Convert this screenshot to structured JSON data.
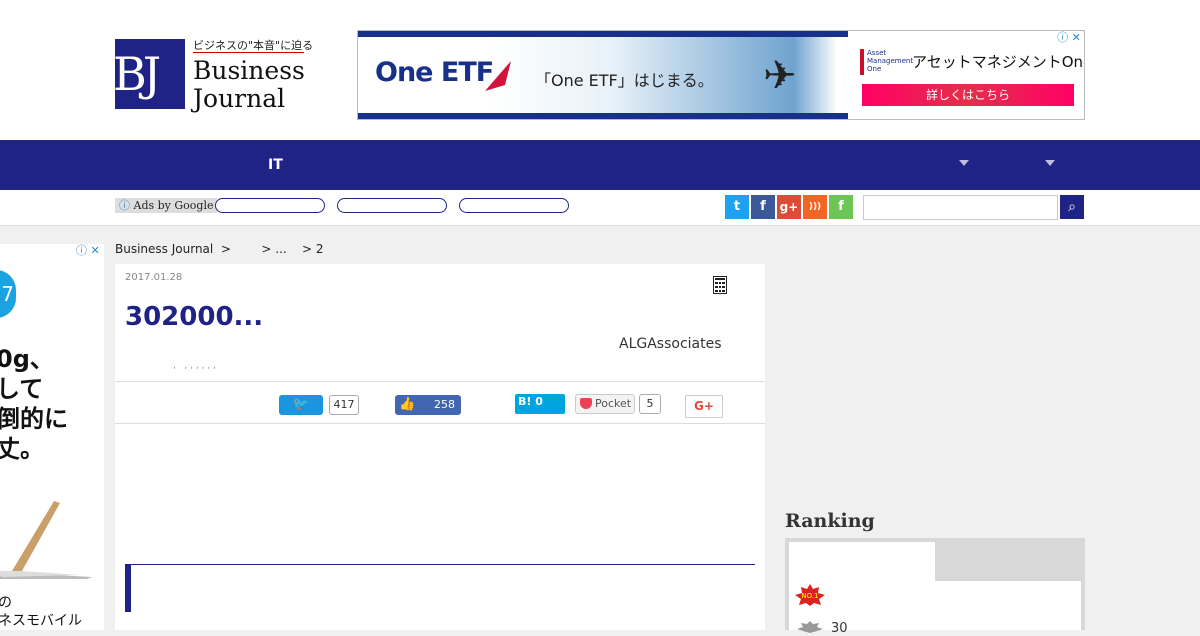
{
  "header": {
    "logo": {
      "mark": "BJ",
      "tagline": "ビジネスの\"本音\"に迫る",
      "word1": "Business",
      "word2": "Journal"
    },
    "ad": {
      "brand": "One ETF",
      "copy": "「One ETF」はじまる。",
      "company_logo": "Asset Management One",
      "company": "アセットマネジメントOne",
      "cta": "詳しくはこちら",
      "choices": "ⓘ ✕"
    }
  },
  "nav": {
    "items": [
      "IT"
    ]
  },
  "subbar": {
    "ads_by": "Ads by Google",
    "ads_icon": "ⓘ",
    "social": [
      "twitter",
      "facebook",
      "google-plus",
      "rss",
      "feedly"
    ],
    "social_glyphs": {
      "twitter": "t",
      "facebook": "f",
      "gplus": "g+",
      "rss": ")))",
      "feedly": "f"
    },
    "search_icon": "⌕"
  },
  "side_ad": {
    "choices": "ⓘ ✕",
    "badge": "7",
    "headline": "0g、\nして\n倒的に\n丈。",
    "footer": "の\nネスモバイル"
  },
  "breadcrumb": "Business Journal  >        > ...    > 2",
  "article": {
    "date": "2017.01.28",
    "title": "302000...",
    "author": "ALGAssociates",
    "tagline": ",   , , , , , ,",
    "share": {
      "twitter_count": "417",
      "facebook_count": "258",
      "hatena_label": "B! 0",
      "pocket_label": "Pocket",
      "pocket_count": "5",
      "gplus_label": "G+"
    }
  },
  "sidebar": {
    "ranking_heading": "Ranking",
    "rank_badge": "NO.1",
    "second_item": "30"
  },
  "colors": {
    "brand": "#1e2385",
    "twitter": "#1b95e0",
    "facebook": "#4267b2",
    "hatena": "#00a4de",
    "pocket": "#ee4056"
  }
}
